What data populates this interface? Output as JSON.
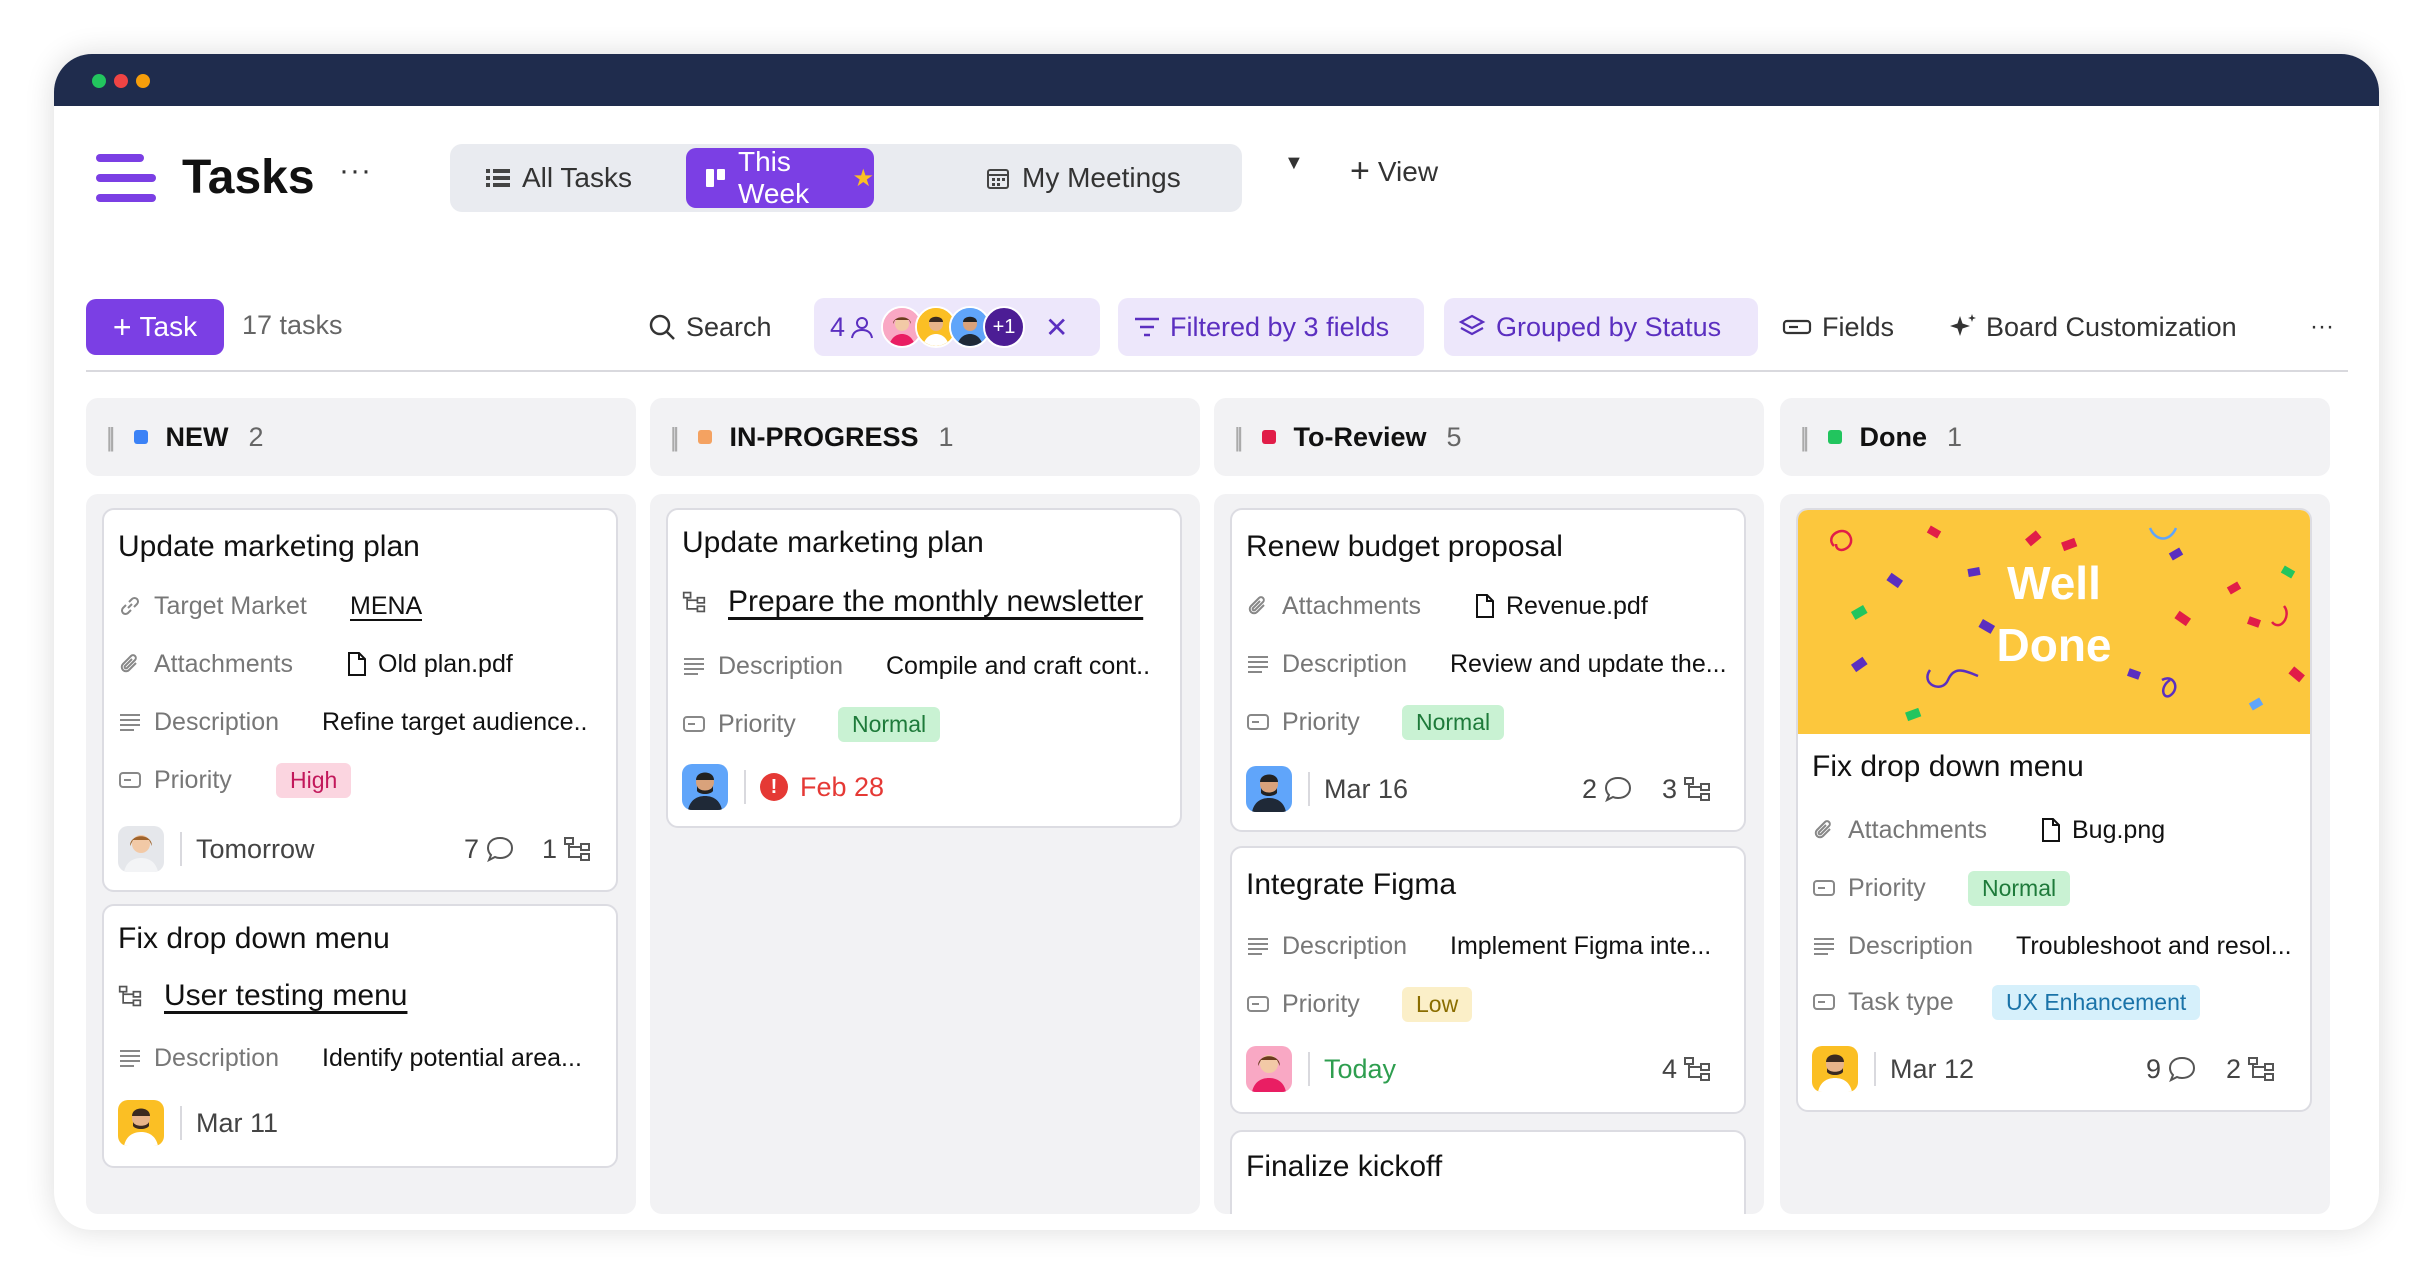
{
  "window": {
    "dots": [
      "#22c55e",
      "#ef4444",
      "#f59e0b"
    ]
  },
  "header": {
    "title": "Tasks",
    "more": "···",
    "views": [
      {
        "label": "All Tasks",
        "icon": "list-icon",
        "active": false
      },
      {
        "label": "This Week",
        "icon": "board-icon",
        "active": true
      },
      {
        "label": "My Meetings",
        "icon": "calendar-icon",
        "active": false
      }
    ],
    "add_view": "View"
  },
  "toolbar": {
    "task_button": "Task",
    "task_count": "17 tasks",
    "search": "Search",
    "assignee_count": "4",
    "assignee_more": "+1",
    "filter": "Filtered by 3 fields",
    "group": "Grouped by Status",
    "fields": "Fields",
    "customization": "Board Customization",
    "more": "···"
  },
  "columns": [
    {
      "name": "NEW",
      "count": "2",
      "color": "#3b82f6",
      "cards": [
        {
          "title": "Update marketing plan",
          "rows": [
            {
              "icon": "link-icon",
              "label": "Target Market",
              "value": "MENA",
              "underline": true
            },
            {
              "icon": "paperclip-icon",
              "label": "Attachments",
              "value": "Old plan.pdf",
              "file": true
            },
            {
              "icon": "description-icon",
              "label": "Description",
              "value": "Refine target audience.."
            },
            {
              "icon": "priority-icon",
              "label": "Priority",
              "pill": "High",
              "pill_bg": "#fbd5e0",
              "pill_fg": "#c2185b"
            }
          ],
          "footer": {
            "avatar": "woman-avatar",
            "date": "Tomorrow",
            "comments": "7",
            "subtasks": "1"
          }
        },
        {
          "title": "Fix drop down menu",
          "subtask": "User testing menu",
          "rows": [
            {
              "icon": "description-icon",
              "label": "Description",
              "value": "Identify potential area..."
            }
          ],
          "footer": {
            "avatar": "man-avatar",
            "date": "Mar 11"
          }
        }
      ]
    },
    {
      "name": "IN-PROGRESS",
      "count": "1",
      "color": "#f4a261",
      "cards": [
        {
          "title": "Update marketing plan",
          "subtask": "Prepare the monthly newsletter",
          "rows": [
            {
              "icon": "description-icon",
              "label": "Description",
              "value": "Compile and craft cont.."
            },
            {
              "icon": "priority-icon",
              "label": "Priority",
              "pill": "Normal",
              "pill_bg": "#c9f2d3",
              "pill_fg": "#1e7a3a"
            }
          ],
          "footer": {
            "avatar": "man-avatar",
            "date": "Feb 28",
            "overdue": true
          }
        }
      ]
    },
    {
      "name": "To-Review",
      "count": "5",
      "color": "#e11d48",
      "cards": [
        {
          "title": "Renew budget proposal",
          "rows": [
            {
              "icon": "paperclip-icon",
              "label": "Attachments",
              "value": "Revenue.pdf",
              "file": true
            },
            {
              "icon": "description-icon",
              "label": "Description",
              "value": "Review and update the..."
            },
            {
              "icon": "priority-icon",
              "label": "Priority",
              "pill": "Normal",
              "pill_bg": "#c9f2d3",
              "pill_fg": "#1e7a3a"
            }
          ],
          "footer": {
            "avatar": "man-avatar",
            "date": "Mar 16",
            "comments": "2",
            "subtasks": "3"
          }
        },
        {
          "title": "Integrate Figma",
          "rows": [
            {
              "icon": "description-icon",
              "label": "Description",
              "value": "Implement Figma inte..."
            },
            {
              "icon": "priority-icon",
              "label": "Priority",
              "pill": "Low",
              "pill_bg": "#fbefc8",
              "pill_fg": "#8a6d00"
            }
          ],
          "footer": {
            "avatar": "woman-avatar",
            "date": "Today",
            "today": true,
            "subtasks": "4"
          }
        },
        {
          "title": "Finalize kickoff",
          "rows": []
        }
      ]
    },
    {
      "name": "Done",
      "count": "1",
      "color": "#22c55e",
      "cards": [
        {
          "cover": {
            "line1": "Well",
            "line2": "Done",
            "bg": "#fcc73d"
          },
          "title": "Fix drop down menu",
          "rows": [
            {
              "icon": "paperclip-icon",
              "label": "Attachments",
              "value": "Bug.png",
              "file": true
            },
            {
              "icon": "priority-icon",
              "label": "Priority",
              "pill": "Normal",
              "pill_bg": "#c9f2d3",
              "pill_fg": "#1e7a3a"
            },
            {
              "icon": "description-icon",
              "label": "Description",
              "value": "Troubleshoot and resol..."
            },
            {
              "icon": "tasktype-icon",
              "label": "Task type",
              "pill": "UX Enhancement",
              "pill_bg": "#d6f0fb",
              "pill_fg": "#1a73a8"
            }
          ],
          "footer": {
            "avatar": "man-avatar",
            "date": "Mar 12",
            "comments": "9",
            "subtasks": "2"
          }
        }
      ]
    }
  ]
}
